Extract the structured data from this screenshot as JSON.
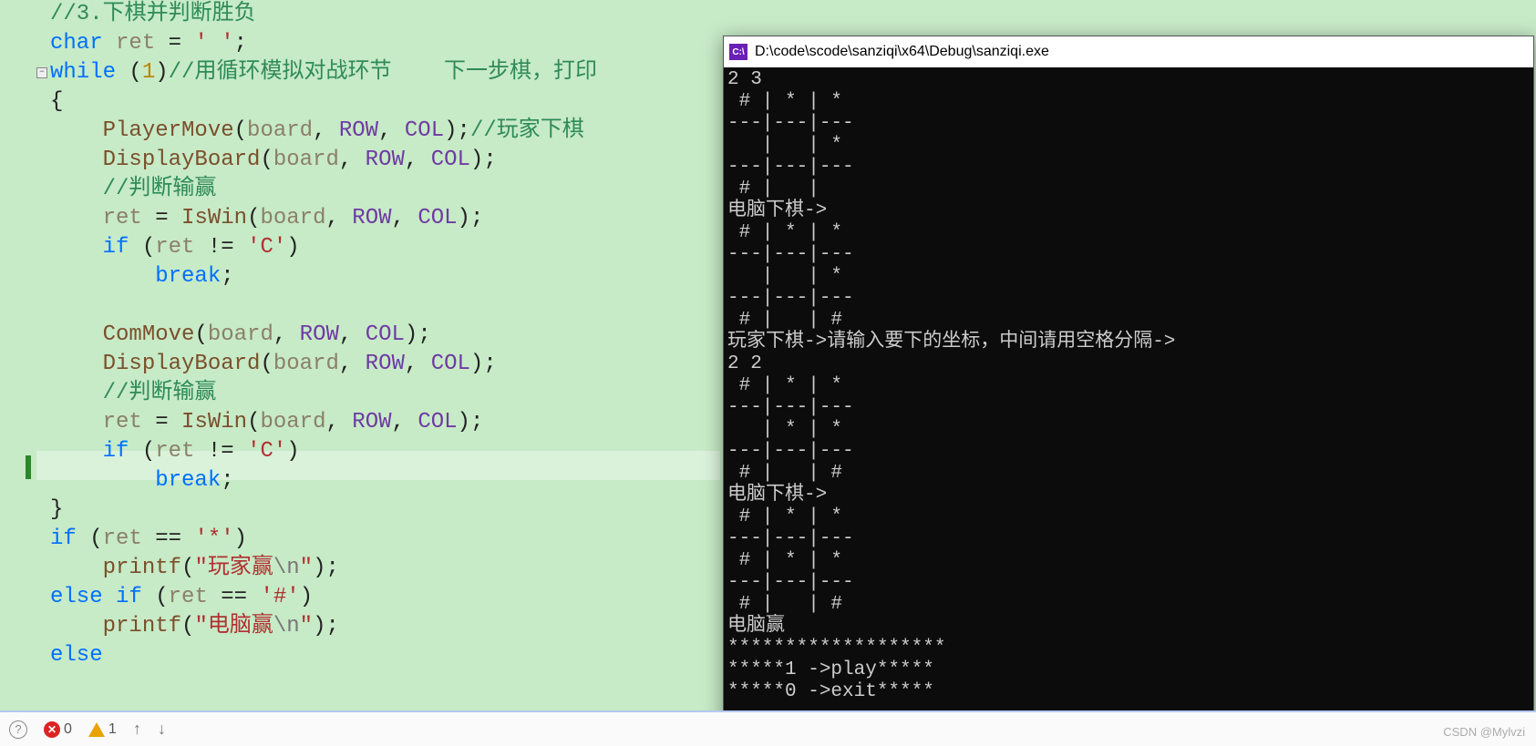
{
  "code": {
    "c1": "//3.下棋并判断胜负",
    "kw_char": "char",
    "id_ret": "ret",
    "eq": " = ",
    "sp_char": "' '",
    "semi": ";",
    "kw_while": "while",
    "num1": "1",
    "c2": "//用循环模拟对战环节    下一步棋，打印",
    "ob": "{",
    "cb": "}",
    "fn_player": "PlayerMove",
    "fn_display": "DisplayBoard",
    "fn_iswin": "IsWin",
    "fn_commove": "ComMove",
    "fn_printf": "printf",
    "id_board": "board",
    "mac_row": "ROW",
    "mac_col": "COL",
    "c_play": "//玩家下棋",
    "c_judge": "//判断输赢",
    "kw_if": "if",
    "kw_else": "else",
    "kw_elseif": "else if",
    "kw_break": "break",
    "ne": " != ",
    "eqeq": " == ",
    "chC": "'C'",
    "chStar": "'*'",
    "chHash": "'#'",
    "str_player": "\"玩家赢",
    "str_com": "\"电脑赢",
    "esc_n": "\\n",
    "str_end": "\""
  },
  "console": {
    "title": "D:\\code\\scode\\sanziqi\\x64\\Debug\\sanziqi.exe",
    "icon_text": "C:\\",
    "lines": [
      "2 3",
      " # | * | *",
      "---|---|---",
      "   |   | *",
      "---|---|---",
      " # |   |",
      "电脑下棋->",
      " # | * | *",
      "---|---|---",
      "   |   | *",
      "---|---|---",
      " # |   | #",
      "玩家下棋->请输入要下的坐标，中间请用空格分隔->",
      "2 2",
      " # | * | *",
      "---|---|---",
      "   | * | *",
      "---|---|---",
      " # |   | #",
      "电脑下棋->",
      " # | * | *",
      "---|---|---",
      " # | * | *",
      "---|---|---",
      " # |   | #",
      "电脑赢",
      "*******************",
      "*****1 ->play*****",
      "*****0 ->exit*****"
    ]
  },
  "statusbar": {
    "errors": "0",
    "warnings": "1"
  },
  "watermark": "CSDN @Mylvzi"
}
